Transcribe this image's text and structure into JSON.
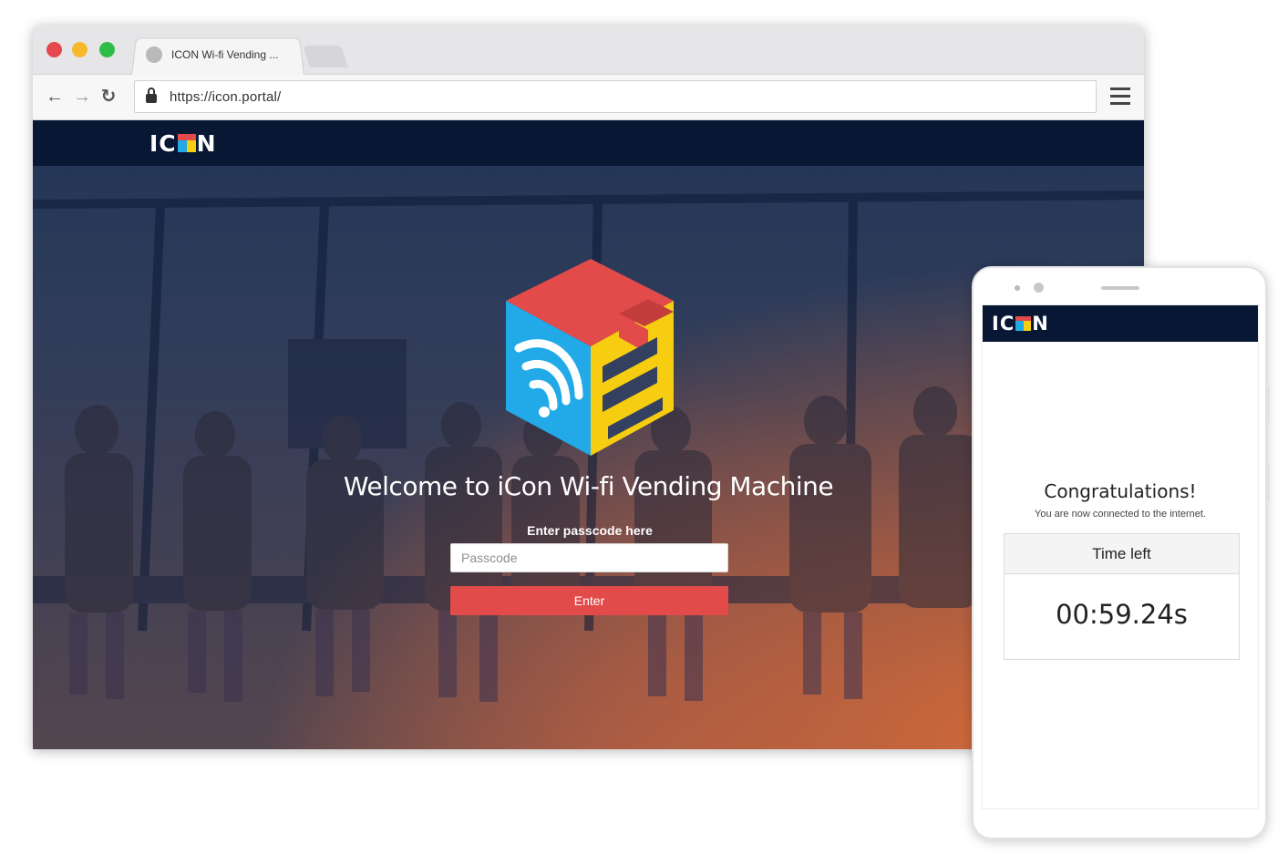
{
  "browser": {
    "tab_title": "ICON Wi-fi Vending ...",
    "url": "https://icon.portal/"
  },
  "portal": {
    "brand": {
      "pre": "IC",
      "post": "N"
    },
    "welcome": "Welcome to iCon Wi-fi Vending Machine",
    "passcode_label": "Enter passcode here",
    "passcode_placeholder": "Passcode",
    "enter_label": "Enter"
  },
  "phone": {
    "brand": {
      "pre": "IC",
      "post": "N"
    },
    "congrats": "Congratulations!",
    "connected": "You are now connected to the internet.",
    "time_left_label": "Time left",
    "time_left_value": "00:59.24s"
  },
  "colors": {
    "navy": "#071734",
    "red": "#e34b4b",
    "blue": "#21a9e8",
    "yellow": "#f6cd11",
    "orange": "#e26e36"
  },
  "icons": [
    "back-arrow-icon",
    "forward-arrow-icon",
    "reload-icon",
    "lock-icon",
    "hamburger-menu-icon",
    "icon-cube-logo",
    "wifi-icon"
  ]
}
